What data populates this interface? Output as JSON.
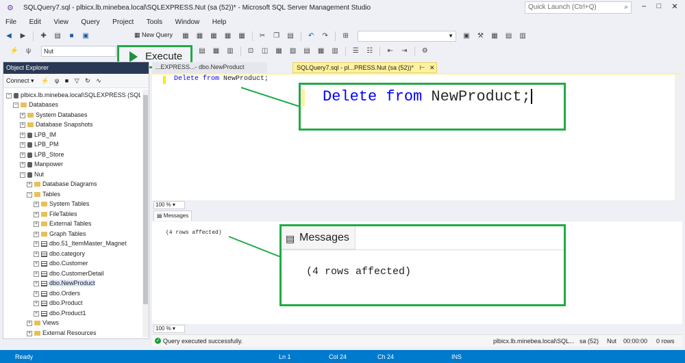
{
  "window": {
    "title": "SQLQuery7.sql - plbicx.lb.minebea.local\\SQLEXPRESS.Nut (sa (52))* - Microsoft SQL Server Management Studio",
    "quick_launch_placeholder": "Quick Launch (Ctrl+Q)"
  },
  "menu": [
    "File",
    "Edit",
    "View",
    "Query",
    "Project",
    "Tools",
    "Window",
    "Help"
  ],
  "toolbar": {
    "new_query": "New Query",
    "database": "Nut",
    "execute": "Execute"
  },
  "object_explorer": {
    "title": "Object Explorer",
    "connect": "Connect",
    "server": "plbicx.lb.minebea.local\\SQLEXPRESS (SQL",
    "nodes": [
      "Databases",
      "System Databases",
      "Database Snapshots",
      "LPB_IM",
      "LPB_PM",
      "LPB_Store",
      "Manpower",
      "Nut",
      "Database Diagrams",
      "Tables",
      "System Tables",
      "FileTables",
      "External Tables",
      "Graph Tables",
      "dbo.51_ItemMaster_Magnet",
      "dbo.category",
      "dbo.Customer",
      "dbo.CustomerDetail",
      "dbo.NewProduct",
      "dbo.Orders",
      "dbo.Product",
      "dbo.Product1",
      "Views",
      "External Resources"
    ]
  },
  "tabs": {
    "tab1": "...EXPRESS...- dbo.NewProduct",
    "tab2": "SQLQuery7.sql - pl...PRESS.Nut (sa (52))*"
  },
  "editor": {
    "kw1": "Delete",
    "kw2": "from",
    "rest": " NewProduct;",
    "zoom": "100 %"
  },
  "results": {
    "tab": "Messages",
    "message": "(4 rows affected)",
    "zoom": "100 %"
  },
  "query_status": {
    "message": "Query executed successfully.",
    "server": "plbicx.lb.minebea.local\\SQL...",
    "user": "sa (52)",
    "db": "Nut",
    "time": "00:00:00",
    "rows": "0 rows"
  },
  "statusbar": {
    "ready": "Ready",
    "line": "Ln 1",
    "col": "Col 24",
    "ch": "Ch 24",
    "mode": "INS"
  },
  "callouts": {
    "code_kw1": "Delete",
    "code_kw2": "from",
    "code_rest": " NewProduct;",
    "messages_label": "Messages",
    "messages_text": "(4 rows affected)"
  },
  "colors": {
    "highlight": "#1faa45",
    "statusbar": "#007acc",
    "keyword": "#0000ff"
  }
}
